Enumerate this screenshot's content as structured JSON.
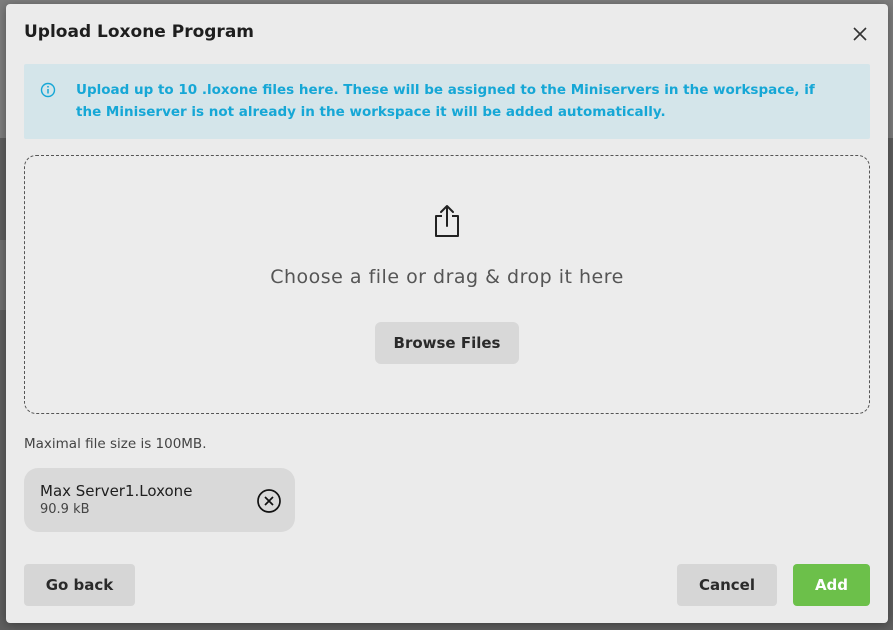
{
  "modal": {
    "title": "Upload Loxone Program",
    "close_icon": "close-icon"
  },
  "info": {
    "icon": "info-icon",
    "text": "Upload up to 10 .loxone files here. These will be assigned to the Miniservers in the workspace, if the Miniserver is not already in the workspace it will be added automatically.",
    "color": "#16a7d6",
    "background": "#d4e5ea"
  },
  "dropzone": {
    "icon": "upload-icon",
    "text": "Choose a file or drag & drop it here",
    "browse_label": "Browse Files"
  },
  "max_size_text": "Maximal file size is 100MB.",
  "files": [
    {
      "name": "Max Server1.Loxone",
      "size": "90.9 kB",
      "remove_icon": "remove-circle-icon"
    }
  ],
  "footer": {
    "back_label": "Go back",
    "cancel_label": "Cancel",
    "add_label": "Add",
    "add_color": "#6cc04a"
  }
}
